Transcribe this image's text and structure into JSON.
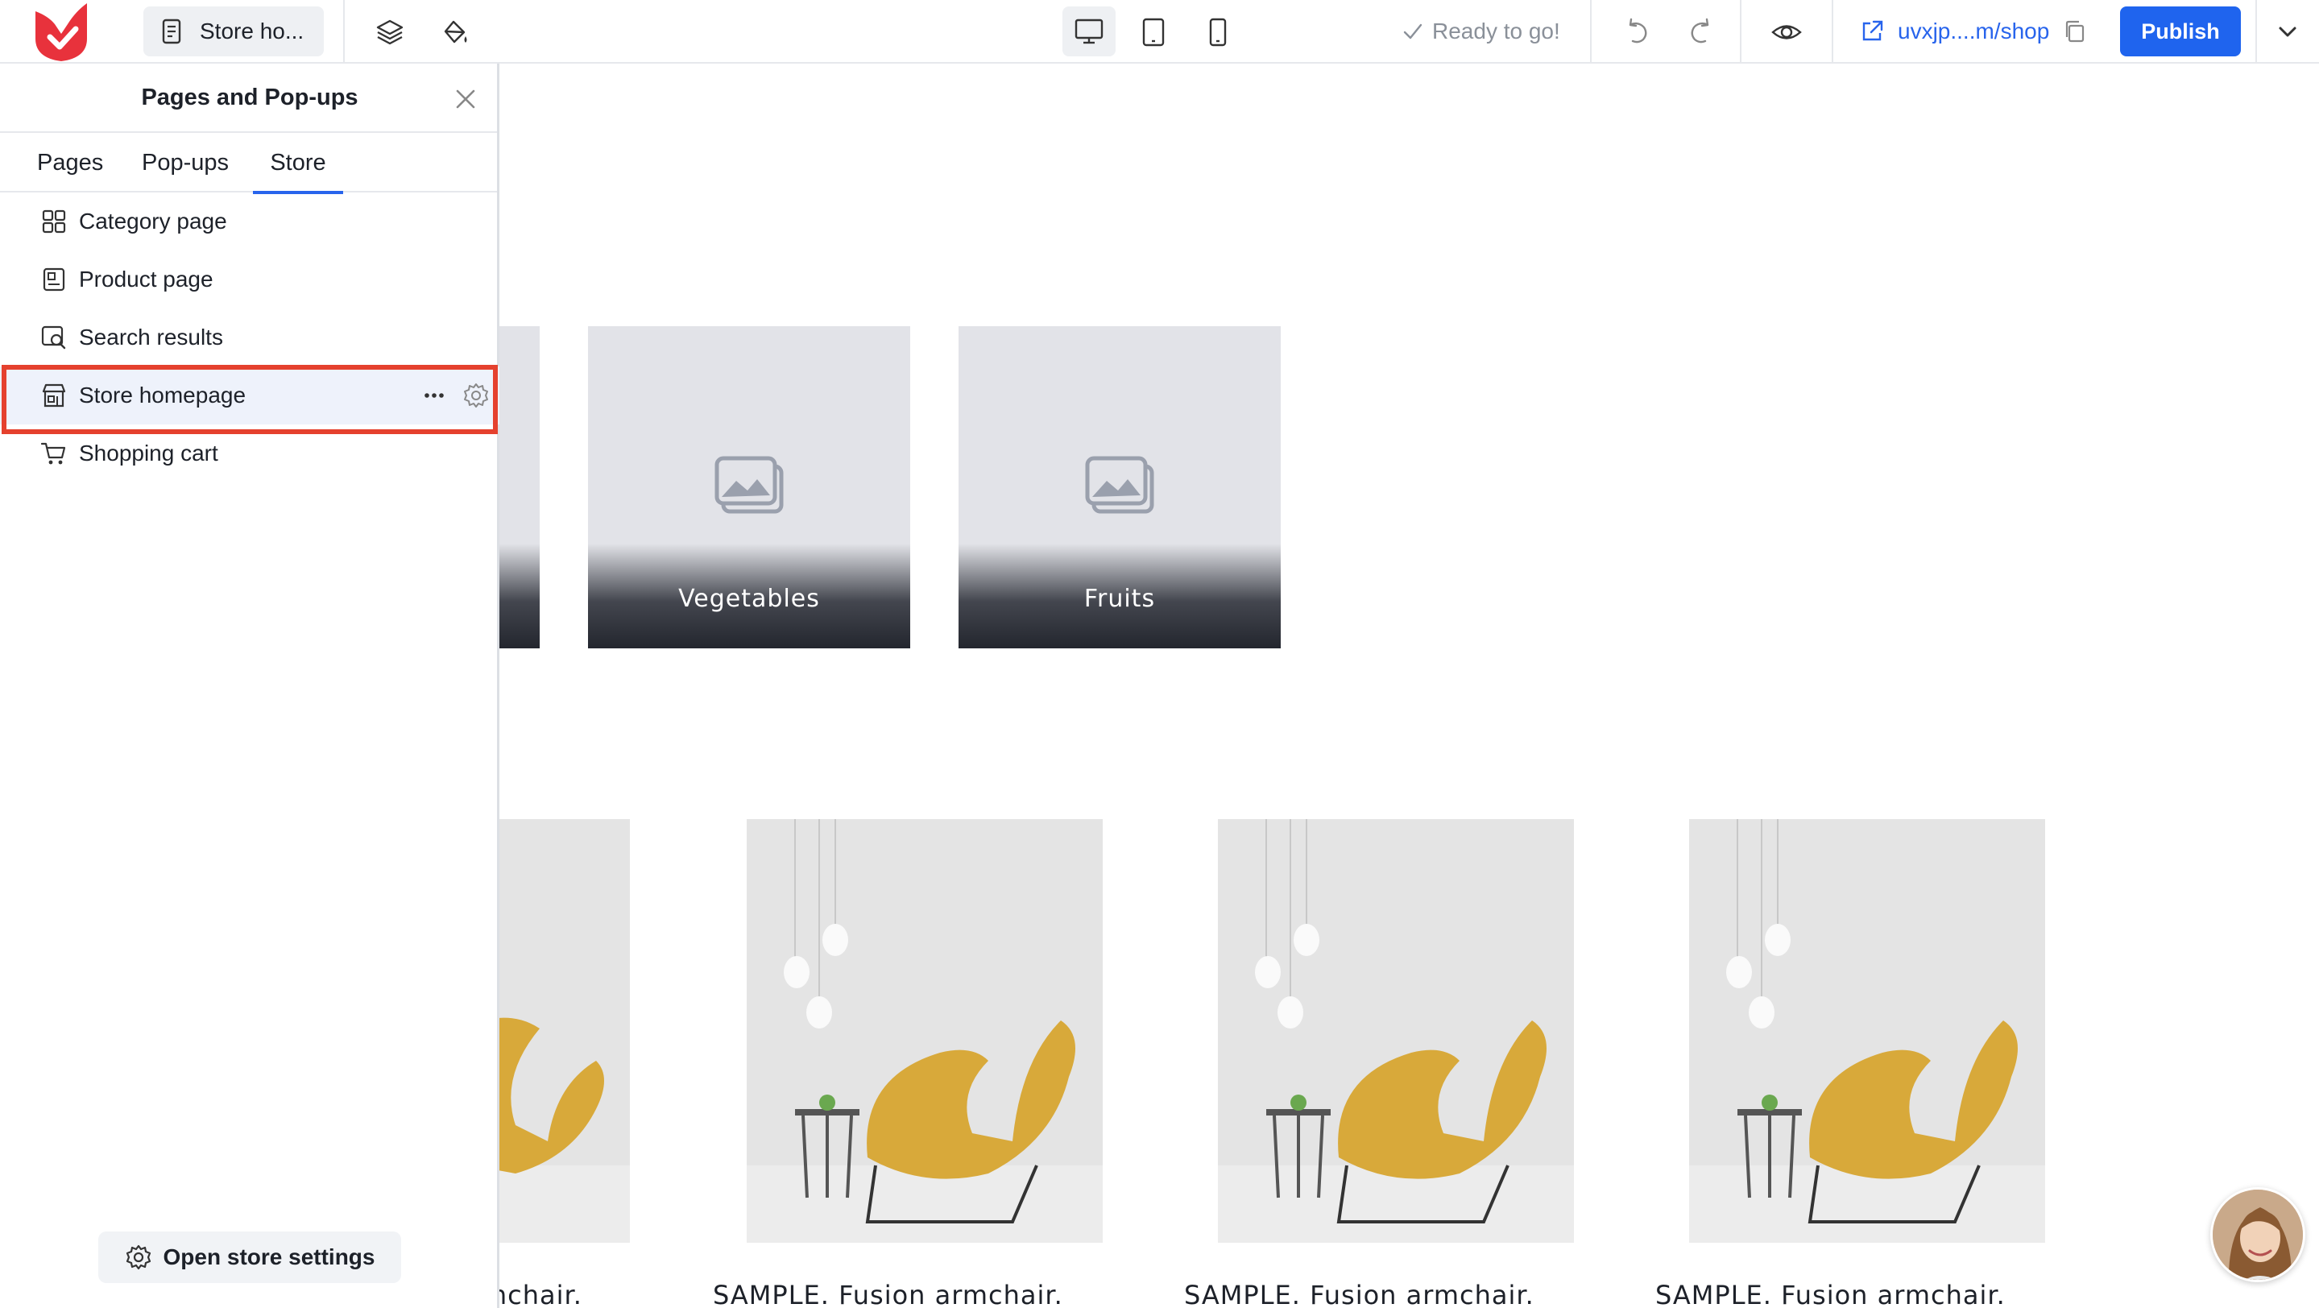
{
  "topbar": {
    "current_page": "Store ho...",
    "status": "Ready to go!",
    "site_link": "uvxjp....m/shop",
    "publish_label": "Publish"
  },
  "panel": {
    "title": "Pages and Pop-ups",
    "tabs": [
      {
        "label": "Pages"
      },
      {
        "label": "Pop-ups"
      },
      {
        "label": "Store",
        "active": true
      }
    ],
    "items": [
      {
        "label": "Category page",
        "icon": "grid-icon"
      },
      {
        "label": "Product page",
        "icon": "product-page-icon"
      },
      {
        "label": "Search results",
        "icon": "search-results-icon"
      },
      {
        "label": "Store homepage",
        "icon": "store-icon",
        "selected": true
      },
      {
        "label": "Shopping cart",
        "icon": "cart-icon"
      }
    ],
    "store_settings_label": "Open store settings"
  },
  "canvas": {
    "categories": [
      {
        "label": "Vegetables"
      },
      {
        "label": "Fruits"
      }
    ],
    "products": [
      {
        "title": "SAMPLE. Fusion armchair."
      },
      {
        "title": "SAMPLE. Fusion armchair."
      },
      {
        "title": "SAMPLE. Fusion armchair."
      },
      {
        "title": "mchair."
      }
    ]
  },
  "colors": {
    "accent": "#1f64ee",
    "link": "#2864ec",
    "highlight": "#e5412e",
    "brand": "#e8323c"
  }
}
